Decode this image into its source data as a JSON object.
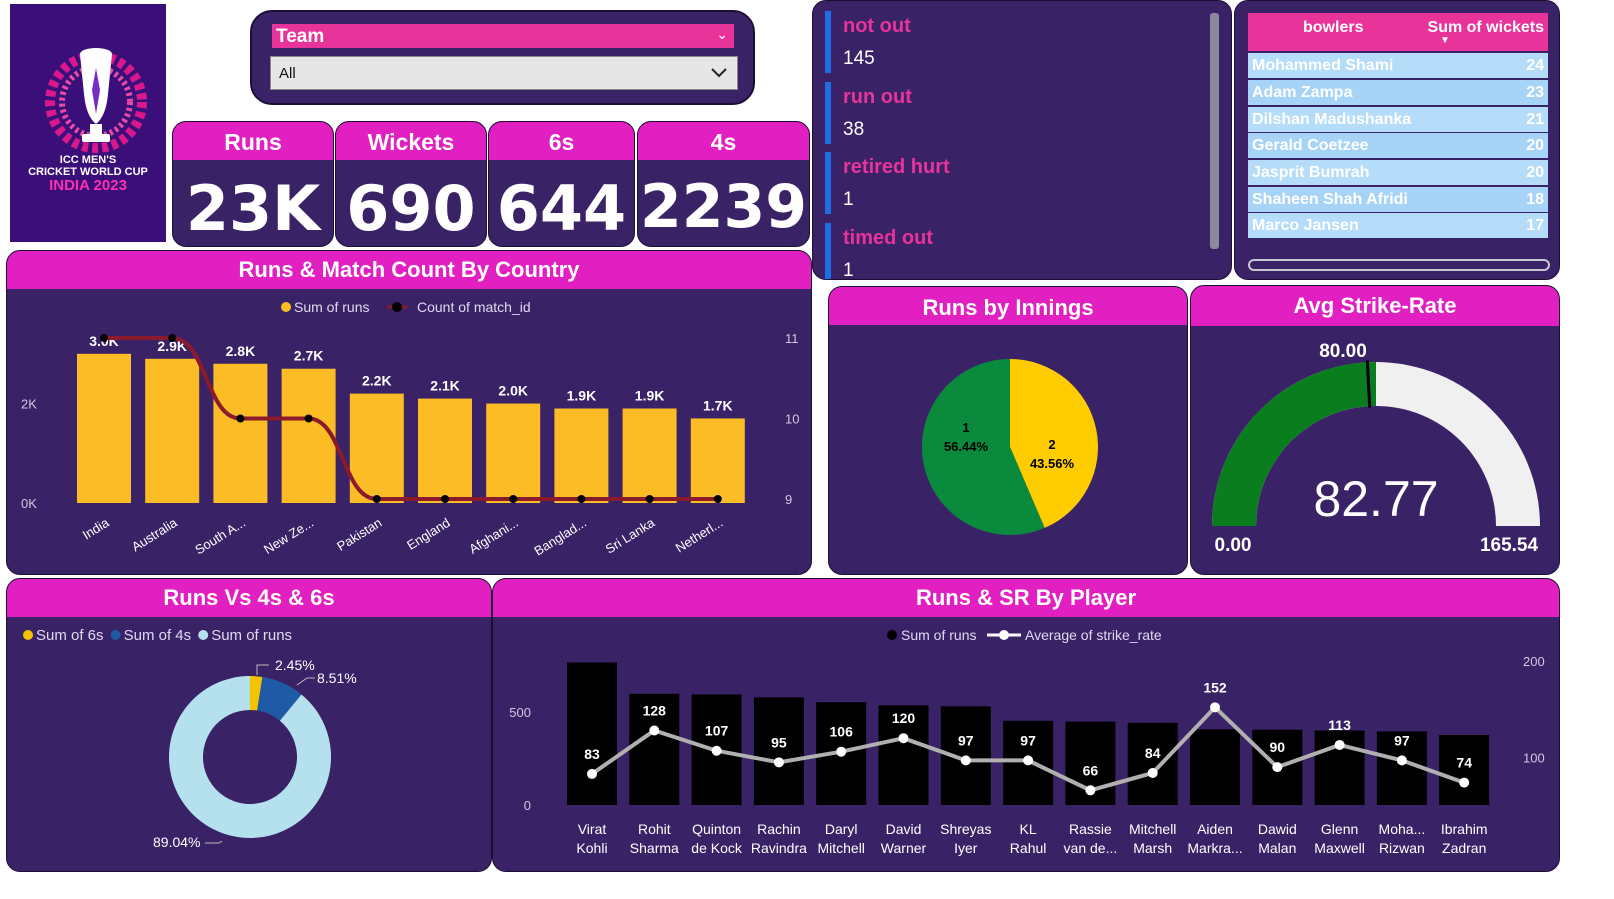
{
  "logo": {
    "line1": "ICC MEN'S",
    "line2": "CRICKET WORLD CUP",
    "line3": "INDIA 2023"
  },
  "filter": {
    "label": "Team",
    "value": "All"
  },
  "kpis": [
    {
      "label": "Runs",
      "value": "23K"
    },
    {
      "label": "Wickets",
      "value": "690"
    },
    {
      "label": "6s",
      "value": "644"
    },
    {
      "label": "4s",
      "value": "2239"
    }
  ],
  "dismissals": [
    {
      "label": "not out",
      "value": "145"
    },
    {
      "label": "run out",
      "value": "38"
    },
    {
      "label": "retired hurt",
      "value": "1"
    },
    {
      "label": "timed out",
      "value": "1"
    }
  ],
  "bowlers_table": {
    "headers": [
      "bowlers",
      "Sum of wickets"
    ],
    "rows": [
      [
        "Mohammed Shami",
        "24"
      ],
      [
        "Adam Zampa",
        "23"
      ],
      [
        "Dilshan Madushanka",
        "21"
      ],
      [
        "Gerald Coetzee",
        "20"
      ],
      [
        "Jasprit Bumrah",
        "20"
      ],
      [
        "Shaheen Shah Afridi",
        "18"
      ],
      [
        "Marco Jansen",
        "17"
      ]
    ]
  },
  "titles": {
    "country": "Runs & Match Count By Country",
    "innings": "Runs by Innings",
    "strike": "Avg Strike-Rate",
    "boundaries": "Runs Vs 4s & 6s",
    "player": "Runs & SR By Player"
  },
  "chart_data": [
    {
      "type": "bar",
      "title": "Runs & Match Count By Country",
      "categories": [
        "India",
        "Australia",
        "South A...",
        "New Ze...",
        "Pakistan",
        "England",
        "Afghani...",
        "Banglad...",
        "Sri Lanka",
        "Netherl..."
      ],
      "series": [
        {
          "name": "Sum of runs",
          "type": "bar",
          "color": "#fbbc26",
          "values": [
            3000,
            2900,
            2800,
            2700,
            2200,
            2100,
            2000,
            1900,
            1900,
            1700
          ],
          "labels": [
            "3.0K",
            "2.9K",
            "2.8K",
            "2.7K",
            "2.2K",
            "2.1K",
            "2.0K",
            "1.9K",
            "1.9K",
            "1.7K"
          ]
        },
        {
          "name": "Count of match_id",
          "type": "line",
          "color": "#8b1a2c",
          "values": [
            11,
            11,
            10,
            10,
            9,
            9,
            9,
            9,
            9,
            9
          ]
        }
      ],
      "y_ticks": [
        "0K",
        "2K"
      ],
      "ylim": [
        0,
        3700
      ],
      "y2_ticks": [
        "9",
        "10",
        "11"
      ],
      "y2lim": [
        9,
        11
      ],
      "legend": "top-center"
    },
    {
      "type": "pie",
      "title": "Runs by Innings",
      "slices": [
        {
          "label": "1",
          "pct": 56.44,
          "text": "56.44%",
          "color": "#0a8a3c"
        },
        {
          "label": "2",
          "pct": 43.56,
          "text": "43.56%",
          "color": "#ffcc00"
        }
      ]
    },
    {
      "type": "gauge",
      "title": "Avg Strike-Rate",
      "value": 82.77,
      "value_text": "82.77",
      "min": 0,
      "min_text": "0.00",
      "max": 165.54,
      "max_text": "165.54",
      "target": 80.0,
      "target_text": "80.00",
      "fill_color": "#0a7d1f",
      "track_color": "#f0f0f0"
    },
    {
      "type": "pie",
      "title": "Runs Vs 4s & 6s",
      "donut": true,
      "legend": "top-left",
      "slices": [
        {
          "label": "Sum of 6s",
          "pct": 2.45,
          "text": "2.45%",
          "color": "#f5c400"
        },
        {
          "label": "Sum of 4s",
          "pct": 8.51,
          "text": "8.51%",
          "color": "#1f5aa6"
        },
        {
          "label": "Sum of runs",
          "pct": 89.04,
          "text": "89.04%",
          "color": "#b5e0ee"
        }
      ]
    },
    {
      "type": "bar",
      "title": "Runs & SR By Player",
      "categories": [
        "Virat Kohli",
        "Rohit Sharma",
        "Quinton de Kock",
        "Rachin Ravindra",
        "Daryl Mitchell",
        "David Warner",
        "Shreyas Iyer",
        "KL Rahul",
        "Rassie van de...",
        "Mitchell Marsh",
        "Aiden Markra...",
        "Dawid Malan",
        "Glenn Maxwell",
        "Moha... Rizwan",
        "Ibrahim Zadran"
      ],
      "series": [
        {
          "name": "Sum of runs",
          "type": "bar",
          "color": "#000000",
          "values": [
            765,
            597,
            594,
            578,
            552,
            535,
            530,
            452,
            448,
            441,
            406,
            404,
            400,
            395,
            376
          ]
        },
        {
          "name": "Average of strike_rate",
          "type": "line",
          "color": "#b0b0b0",
          "values": [
            83,
            128,
            107,
            95,
            106,
            120,
            97,
            97,
            66,
            84,
            152,
            90,
            113,
            97,
            74
          ]
        }
      ],
      "y_ticks": [
        "0",
        "500"
      ],
      "ylim": [
        0,
        800
      ],
      "y2_ticks": [
        "100",
        "200"
      ],
      "y2lim": [
        0,
        200
      ],
      "legend": "top-center"
    }
  ]
}
